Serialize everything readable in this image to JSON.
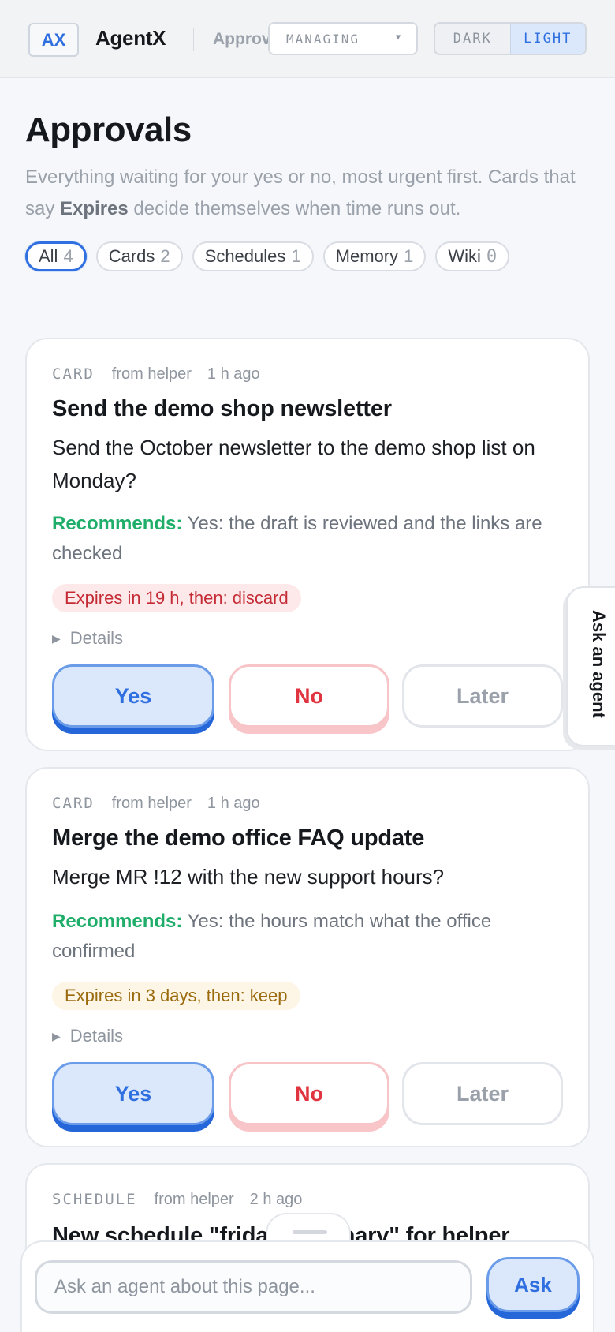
{
  "topbar": {
    "logo": "AX",
    "app_name": "AgentX",
    "crumb": "Approvals",
    "managing": "MANAGING",
    "theme": {
      "dark": "DARK",
      "light": "LIGHT",
      "active": "LIGHT"
    }
  },
  "header": {
    "title": "Approvals",
    "intro_part1": "Everything waiting for your yes or no, most urgent first. Cards that say ",
    "intro_bold": "Expires",
    "intro_part2": " decide themselves when time runs out."
  },
  "filters": [
    {
      "label": "All",
      "count": "4",
      "active": true
    },
    {
      "label": "Cards",
      "count": "2"
    },
    {
      "label": "Schedules",
      "count": "1"
    },
    {
      "label": "Memory",
      "count": "1"
    },
    {
      "label": "Wiki",
      "count": "0"
    }
  ],
  "cards": [
    {
      "kind": "CARD",
      "from": "from helper",
      "age": "1 h ago",
      "title": "Send the demo shop newsletter",
      "question": "Send the October newsletter to the demo shop list on Monday?",
      "recommends_label": "Recommends:",
      "recommends_text": "Yes: the draft is reviewed and the links are checked",
      "expires": "Expires in 19 h, then: discard",
      "expires_color": "#c42b35",
      "details": "Details",
      "yes": "Yes",
      "no": "No",
      "later": "Later"
    },
    {
      "kind": "CARD",
      "from": "from helper",
      "age": "1 h ago",
      "title": "Merge the demo office FAQ update",
      "question": "Merge MR !12 with the new support hours?",
      "recommends_label": "Recommends:",
      "recommends_text": "Yes: the hours match what the office confirmed",
      "expires": "Expires in 3 days, then: keep",
      "expires_color": "#9a6a0c",
      "details": "Details",
      "yes": "Yes",
      "no": "No",
      "later": "Later"
    },
    {
      "kind": "SCHEDULE",
      "from": "from helper",
      "age": "2 h ago",
      "title": "New schedule \"friday-summary\" for helper"
    }
  ],
  "side_tab": "Ask an agent",
  "ask": {
    "placeholder": "Ask an agent about this page...",
    "button": "Ask"
  }
}
